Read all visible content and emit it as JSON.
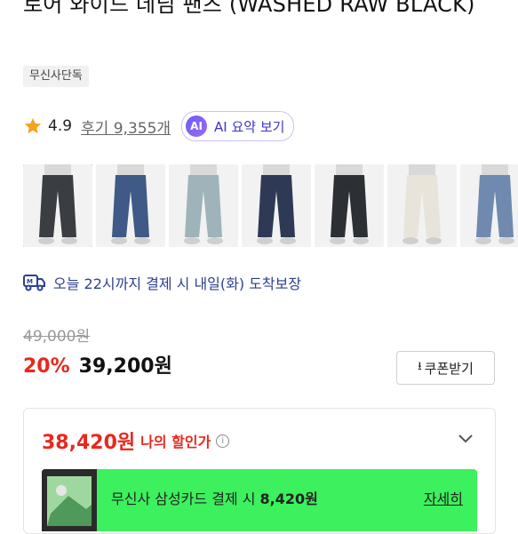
{
  "product": {
    "title": "로어 와이드 데님 팬츠 (WASHED RAW BLACK)",
    "badge": "무신사단독"
  },
  "rating": {
    "score": "4.9",
    "reviews": "후기 9,355개",
    "ai_icon_text": "AI",
    "ai_label": "AI 요약 보기"
  },
  "thumbnails": [
    {
      "label": "washed raw black",
      "color": "#3a3d42"
    },
    {
      "label": "blue",
      "color": "#3f5a86"
    },
    {
      "label": "light blue",
      "color": "#9fb3ba"
    },
    {
      "label": "dark indigo",
      "color": "#2e3a55"
    },
    {
      "label": "black",
      "color": "#2c2f34"
    },
    {
      "label": "ecru",
      "color": "#e8e4da"
    },
    {
      "label": "mid blue",
      "color": "#6f8aae"
    }
  ],
  "delivery": {
    "text": "오늘 22시까지 결제 시 내일(화) 도착보장"
  },
  "price": {
    "original": "49,000원",
    "discount": "20%",
    "sale": "39,200원",
    "coupon_label": "쿠폰받기"
  },
  "my_price": {
    "amount": "38,420원",
    "label": "나의 할인가"
  },
  "promo": {
    "text_prefix": "무신사 삼성카드 결제 시 ",
    "text_amount": "8,420원",
    "link": "자세히"
  },
  "colors": {
    "accent_red": "#e8281e",
    "promo_green": "#3df05d",
    "delivery_blue": "#2e3f8f",
    "ai_purple": "#3b34c8"
  }
}
